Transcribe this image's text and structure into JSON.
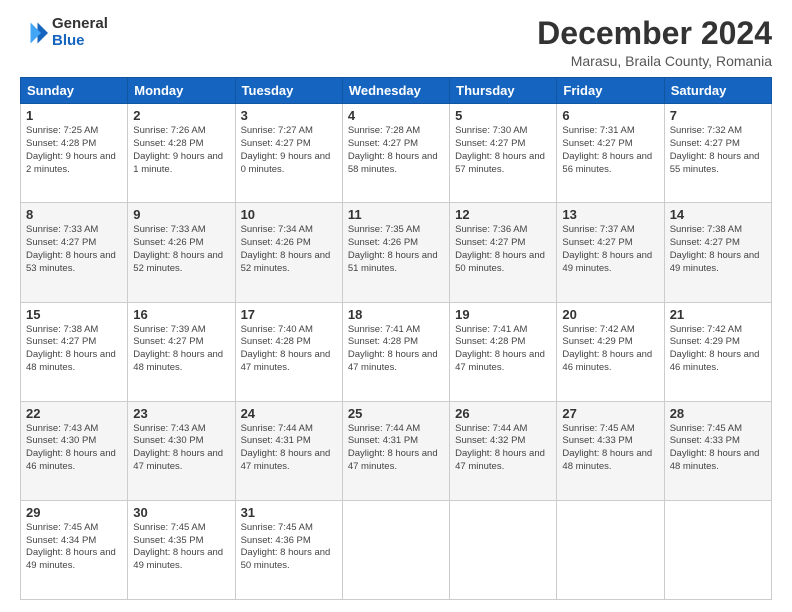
{
  "header": {
    "logo_line1": "General",
    "logo_line2": "Blue",
    "title": "December 2024",
    "subtitle": "Marasu, Braila County, Romania"
  },
  "weekdays": [
    "Sunday",
    "Monday",
    "Tuesday",
    "Wednesday",
    "Thursday",
    "Friday",
    "Saturday"
  ],
  "weeks": [
    [
      {
        "day": 1,
        "sunrise": "7:25 AM",
        "sunset": "4:28 PM",
        "daylight": "9 hours and 2 minutes."
      },
      {
        "day": 2,
        "sunrise": "7:26 AM",
        "sunset": "4:28 PM",
        "daylight": "9 hours and 1 minute."
      },
      {
        "day": 3,
        "sunrise": "7:27 AM",
        "sunset": "4:27 PM",
        "daylight": "9 hours and 0 minutes."
      },
      {
        "day": 4,
        "sunrise": "7:28 AM",
        "sunset": "4:27 PM",
        "daylight": "8 hours and 58 minutes."
      },
      {
        "day": 5,
        "sunrise": "7:30 AM",
        "sunset": "4:27 PM",
        "daylight": "8 hours and 57 minutes."
      },
      {
        "day": 6,
        "sunrise": "7:31 AM",
        "sunset": "4:27 PM",
        "daylight": "8 hours and 56 minutes."
      },
      {
        "day": 7,
        "sunrise": "7:32 AM",
        "sunset": "4:27 PM",
        "daylight": "8 hours and 55 minutes."
      }
    ],
    [
      {
        "day": 8,
        "sunrise": "7:33 AM",
        "sunset": "4:27 PM",
        "daylight": "8 hours and 53 minutes."
      },
      {
        "day": 9,
        "sunrise": "7:33 AM",
        "sunset": "4:26 PM",
        "daylight": "8 hours and 52 minutes."
      },
      {
        "day": 10,
        "sunrise": "7:34 AM",
        "sunset": "4:26 PM",
        "daylight": "8 hours and 52 minutes."
      },
      {
        "day": 11,
        "sunrise": "7:35 AM",
        "sunset": "4:26 PM",
        "daylight": "8 hours and 51 minutes."
      },
      {
        "day": 12,
        "sunrise": "7:36 AM",
        "sunset": "4:27 PM",
        "daylight": "8 hours and 50 minutes."
      },
      {
        "day": 13,
        "sunrise": "7:37 AM",
        "sunset": "4:27 PM",
        "daylight": "8 hours and 49 minutes."
      },
      {
        "day": 14,
        "sunrise": "7:38 AM",
        "sunset": "4:27 PM",
        "daylight": "8 hours and 49 minutes."
      }
    ],
    [
      {
        "day": 15,
        "sunrise": "7:38 AM",
        "sunset": "4:27 PM",
        "daylight": "8 hours and 48 minutes."
      },
      {
        "day": 16,
        "sunrise": "7:39 AM",
        "sunset": "4:27 PM",
        "daylight": "8 hours and 48 minutes."
      },
      {
        "day": 17,
        "sunrise": "7:40 AM",
        "sunset": "4:28 PM",
        "daylight": "8 hours and 47 minutes."
      },
      {
        "day": 18,
        "sunrise": "7:41 AM",
        "sunset": "4:28 PM",
        "daylight": "8 hours and 47 minutes."
      },
      {
        "day": 19,
        "sunrise": "7:41 AM",
        "sunset": "4:28 PM",
        "daylight": "8 hours and 47 minutes."
      },
      {
        "day": 20,
        "sunrise": "7:42 AM",
        "sunset": "4:29 PM",
        "daylight": "8 hours and 46 minutes."
      },
      {
        "day": 21,
        "sunrise": "7:42 AM",
        "sunset": "4:29 PM",
        "daylight": "8 hours and 46 minutes."
      }
    ],
    [
      {
        "day": 22,
        "sunrise": "7:43 AM",
        "sunset": "4:30 PM",
        "daylight": "8 hours and 46 minutes."
      },
      {
        "day": 23,
        "sunrise": "7:43 AM",
        "sunset": "4:30 PM",
        "daylight": "8 hours and 47 minutes."
      },
      {
        "day": 24,
        "sunrise": "7:44 AM",
        "sunset": "4:31 PM",
        "daylight": "8 hours and 47 minutes."
      },
      {
        "day": 25,
        "sunrise": "7:44 AM",
        "sunset": "4:31 PM",
        "daylight": "8 hours and 47 minutes."
      },
      {
        "day": 26,
        "sunrise": "7:44 AM",
        "sunset": "4:32 PM",
        "daylight": "8 hours and 47 minutes."
      },
      {
        "day": 27,
        "sunrise": "7:45 AM",
        "sunset": "4:33 PM",
        "daylight": "8 hours and 48 minutes."
      },
      {
        "day": 28,
        "sunrise": "7:45 AM",
        "sunset": "4:33 PM",
        "daylight": "8 hours and 48 minutes."
      }
    ],
    [
      {
        "day": 29,
        "sunrise": "7:45 AM",
        "sunset": "4:34 PM",
        "daylight": "8 hours and 49 minutes."
      },
      {
        "day": 30,
        "sunrise": "7:45 AM",
        "sunset": "4:35 PM",
        "daylight": "8 hours and 49 minutes."
      },
      {
        "day": 31,
        "sunrise": "7:45 AM",
        "sunset": "4:36 PM",
        "daylight": "8 hours and 50 minutes."
      },
      null,
      null,
      null,
      null
    ]
  ]
}
